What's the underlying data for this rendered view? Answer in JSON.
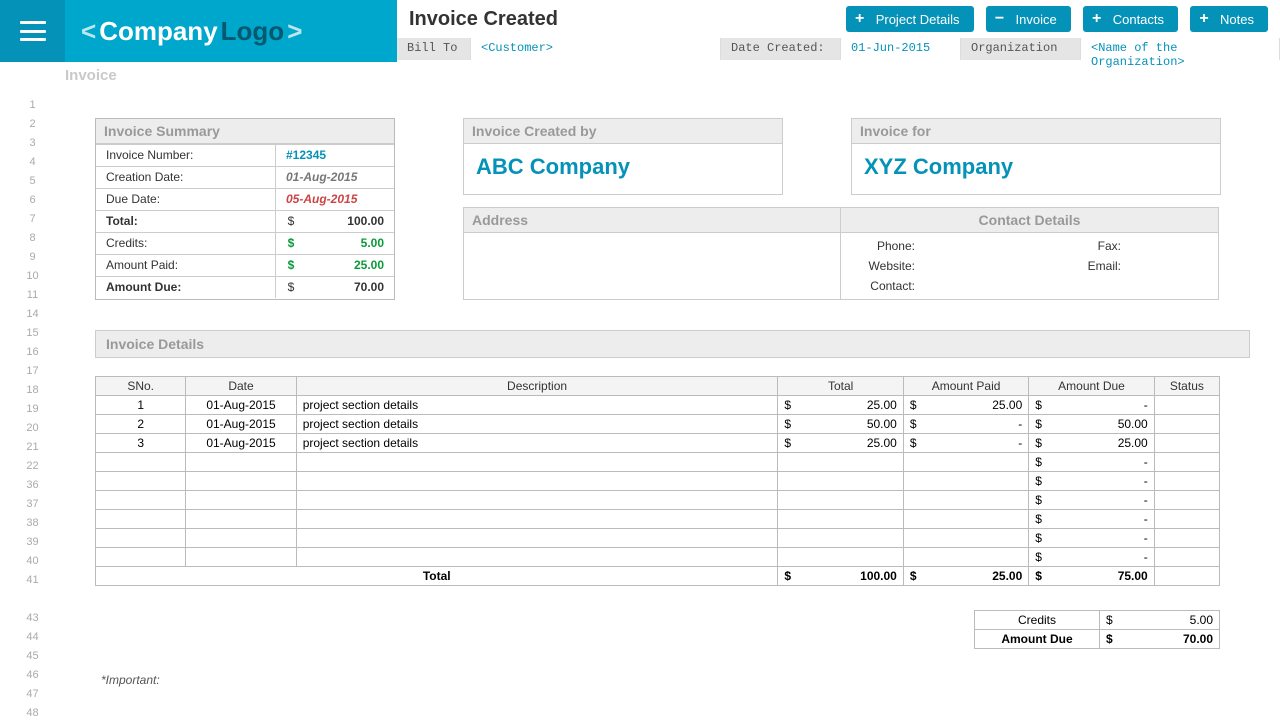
{
  "header": {
    "logo_pre": "<",
    "logo_name": "Company",
    "logo_sub": "Logo",
    "logo_post": ">",
    "page_title": "Invoice Created",
    "buttons": {
      "project": "Project Details",
      "invoice": "Invoice",
      "contacts": "Contacts",
      "notes": "Notes",
      "plus": "+",
      "minus": "−"
    },
    "meta": {
      "bill_to_label": "Bill To",
      "bill_to_value": "<Customer>",
      "date_created_label": "Date Created:",
      "date_created_value": "01-Jun-2015",
      "org_label": "Organization",
      "org_value": "<Name of the Organization>"
    }
  },
  "tab": {
    "invoice": "Invoice"
  },
  "summary": {
    "header": "Invoice Summary",
    "rows": {
      "invoice_number_label": "Invoice Number:",
      "invoice_number_value": "#12345",
      "creation_date_label": "Creation Date:",
      "creation_date_value": "01-Aug-2015",
      "due_date_label": "Due Date:",
      "due_date_value": "05-Aug-2015",
      "total_label": "Total:",
      "total_value": "100.00",
      "credits_label": "Credits:",
      "credits_value": "5.00",
      "paid_label": "Amount Paid:",
      "paid_value": "25.00",
      "due_label": "Amount Due:",
      "due_value": "70.00",
      "currency": "$"
    }
  },
  "created_by": {
    "header": "Invoice Created by",
    "name": "ABC Company"
  },
  "invoice_for": {
    "header": "Invoice for",
    "name": "XYZ Company"
  },
  "address_header": "Address",
  "contact": {
    "header": "Contact Details",
    "phone": "Phone:",
    "fax": "Fax:",
    "website": "Website:",
    "email": "Email:",
    "contact": "Contact:"
  },
  "details": {
    "header": "Invoice Details",
    "cols": {
      "sno": "SNo.",
      "date": "Date",
      "desc": "Description",
      "total": "Total",
      "paid": "Amount Paid",
      "due": "Amount Due",
      "status": "Status"
    },
    "rows": [
      {
        "sno": "1",
        "date": "01-Aug-2015",
        "desc": "project section details",
        "total": "25.00",
        "paid": "25.00",
        "due": "-"
      },
      {
        "sno": "2",
        "date": "01-Aug-2015",
        "desc": "project section details",
        "total": "50.00",
        "paid": "-",
        "due": "50.00"
      },
      {
        "sno": "3",
        "date": "01-Aug-2015",
        "desc": "project section details",
        "total": "25.00",
        "paid": "-",
        "due": "25.00"
      }
    ],
    "totals": {
      "label": "Total",
      "total": "100.00",
      "paid": "25.00",
      "due": "75.00"
    },
    "currency": "$",
    "dash": "-"
  },
  "recap": {
    "credits_label": "Credits",
    "credits_value": "5.00",
    "due_label": "Amount Due",
    "due_value": "70.00",
    "currency": "$"
  },
  "important_label": "*Important:",
  "rownums": [
    "1",
    "2",
    "3",
    "4",
    "5",
    "6",
    "7",
    "8",
    "9",
    "10",
    "11",
    "14",
    "15",
    "16",
    "17",
    "18",
    "19",
    "20",
    "21",
    "22",
    "36",
    "37",
    "38",
    "39",
    "40",
    "41",
    "",
    "43",
    "44",
    "45",
    "46",
    "47",
    "48"
  ]
}
